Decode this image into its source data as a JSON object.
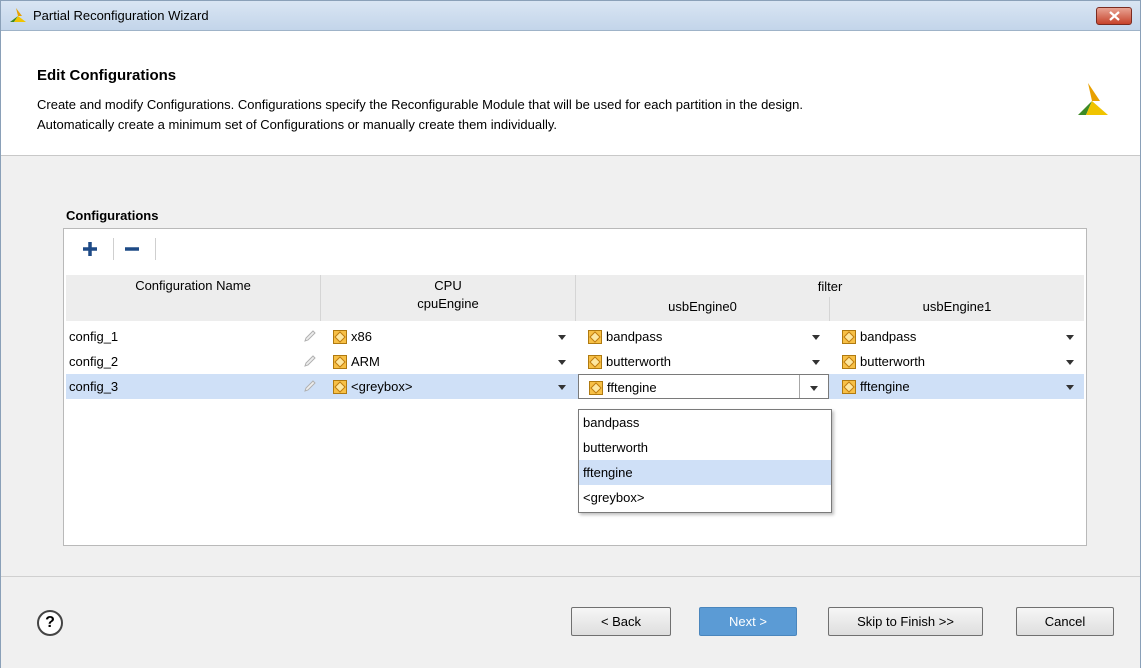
{
  "window": {
    "title": "Partial Reconfiguration Wizard"
  },
  "header": {
    "title": "Edit Configurations",
    "description_line1": "Create and modify Configurations. Configurations specify the Reconfigurable Module that will be used for each partition in the design.",
    "description_line2": "Automatically create a minimum set of Configurations or manually create them individually."
  },
  "configurations": {
    "label": "Configurations",
    "toolbar": {
      "add_icon": "plus-icon",
      "remove_icon": "minus-icon"
    },
    "columns": {
      "name": "Configuration Name",
      "group_cpu": "CPU",
      "cpu_engine": "cpuEngine",
      "group_filter": "filter",
      "usb_engine0": "usbEngine0",
      "usb_engine1": "usbEngine1"
    },
    "rows": [
      {
        "name": "config_1",
        "cpuEngine": "x86",
        "usbEngine0": "bandpass",
        "usbEngine1": "bandpass"
      },
      {
        "name": "config_2",
        "cpuEngine": "ARM",
        "usbEngine0": "butterworth",
        "usbEngine1": "butterworth"
      },
      {
        "name": "config_3",
        "cpuEngine": "<greybox>",
        "usbEngine0": "fftengine",
        "usbEngine1": "fftengine"
      }
    ],
    "dropdown_options": [
      "bandpass",
      "butterworth",
      "fftengine",
      "<greybox>"
    ],
    "dropdown_highlighted": "fftengine"
  },
  "footer": {
    "help_label": "?",
    "back_label": "< Back",
    "next_label": "Next >",
    "skip_label": "Skip to Finish >>",
    "cancel_label": "Cancel"
  },
  "colors": {
    "selection": "#cfe0f7",
    "next_button": "#5b9bd5",
    "module_icon": "#f0a020"
  }
}
